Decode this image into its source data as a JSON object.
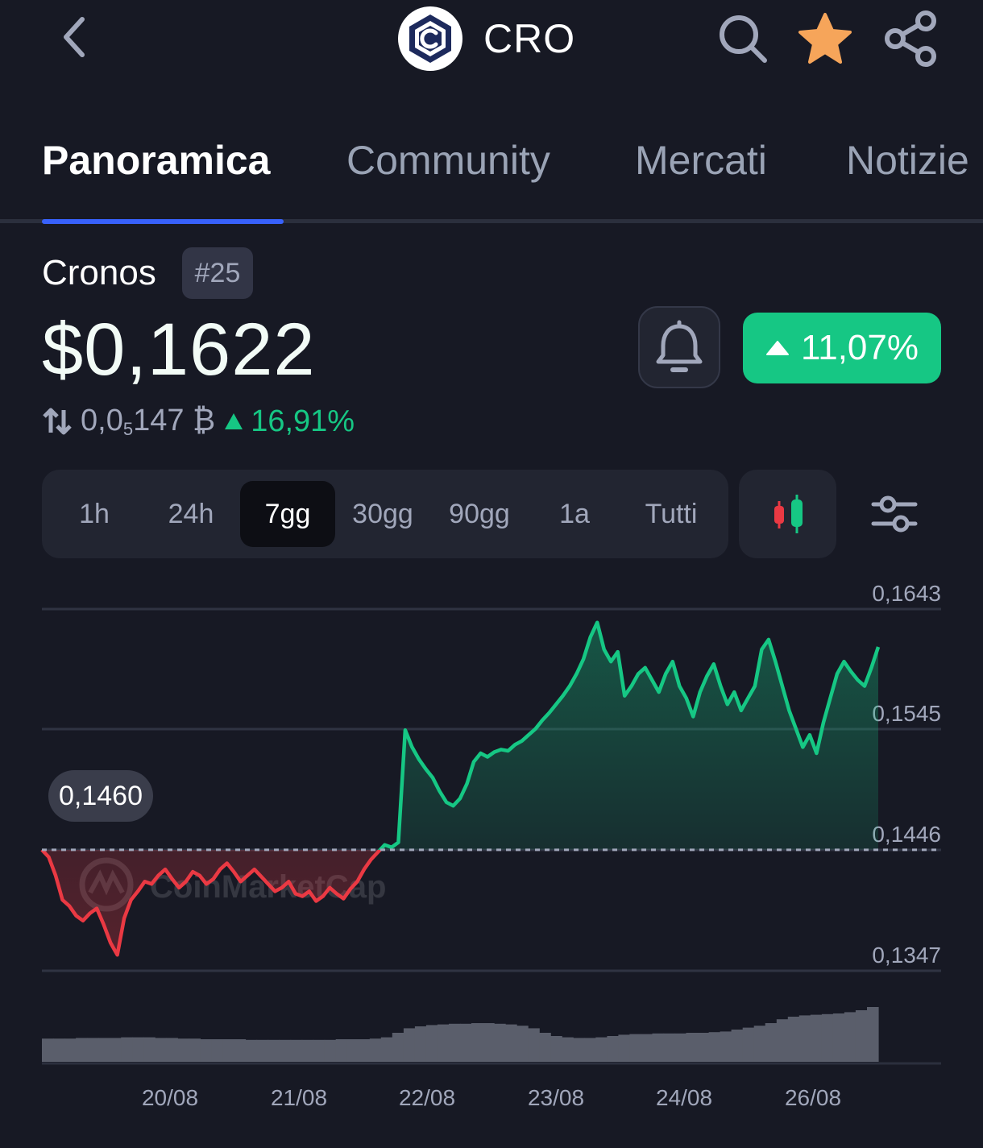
{
  "header": {
    "symbol": "CRO",
    "back_icon": "chevron-left-icon",
    "search_icon": "search-icon",
    "star_icon": "star-icon",
    "share_icon": "share-icon",
    "star_color": "#f6a55a"
  },
  "tabs": [
    {
      "label": "Panoramica",
      "active": true
    },
    {
      "label": "Community",
      "active": false
    },
    {
      "label": "Mercati",
      "active": false
    },
    {
      "label": "Notizie",
      "active": false
    }
  ],
  "coin": {
    "name": "Cronos",
    "rank": "#25",
    "price": "$0,1622",
    "change_24h": "11,07%",
    "btc_price_prefix": "0,0",
    "btc_price_sub": "5",
    "btc_price_suffix": "147",
    "btc_symbol": "₿",
    "btc_change": "16,91%"
  },
  "range": {
    "options": [
      "1h",
      "24h",
      "7gg",
      "30gg",
      "90gg",
      "1a",
      "Tutti"
    ],
    "selected": "7gg"
  },
  "chart_data": {
    "type": "line",
    "title": "",
    "y_ticks": [
      "0,1643",
      "0,1545",
      "0,1446",
      "0,1347"
    ],
    "x_ticks": [
      "20/08",
      "21/08",
      "22/08",
      "23/08",
      "24/08",
      "26/08"
    ],
    "ylim": [
      0.1347,
      0.1643
    ],
    "open_price": 0.1446,
    "open_label": "0,1460",
    "watermark": "CoinMarketCap",
    "colors": {
      "up": "#16c784",
      "down": "#ea3943"
    },
    "series": [
      {
        "values": [
          0.1446,
          0.144,
          0.1425,
          0.1405,
          0.14,
          0.1392,
          0.1388,
          0.1394,
          0.1398,
          0.1385,
          0.137,
          0.136,
          0.139,
          0.1405,
          0.1412,
          0.142,
          0.1418,
          0.1425,
          0.143,
          0.1422,
          0.1415,
          0.142,
          0.1428,
          0.1425,
          0.1418,
          0.1422,
          0.143,
          0.1435,
          0.1428,
          0.142,
          0.1425,
          0.143,
          0.1424,
          0.1418,
          0.1412,
          0.1415,
          0.142,
          0.141,
          0.1408,
          0.1412,
          0.1404,
          0.1408,
          0.1415,
          0.141,
          0.1406,
          0.1414,
          0.142,
          0.143,
          0.1438,
          0.1444,
          0.145,
          0.1448,
          0.1452,
          0.1544,
          0.153,
          0.152,
          0.1512,
          0.1505,
          0.1494,
          0.1485,
          0.1482,
          0.1488,
          0.15,
          0.1518,
          0.1525,
          0.1522,
          0.1526,
          0.1528,
          0.1527,
          0.1532,
          0.1535,
          0.154,
          0.1545,
          0.1552,
          0.1558,
          0.1565,
          0.1572,
          0.158,
          0.159,
          0.1602,
          0.162,
          0.1632,
          0.161,
          0.16,
          0.1608,
          0.1572,
          0.158,
          0.159,
          0.1595,
          0.1585,
          0.1575,
          0.159,
          0.16,
          0.158,
          0.157,
          0.1555,
          0.1575,
          0.1588,
          0.1598,
          0.158,
          0.1565,
          0.1575,
          0.156,
          0.157,
          0.158,
          0.161,
          0.1618,
          0.16,
          0.158,
          0.156,
          0.1545,
          0.153,
          0.154,
          0.1525,
          0.155,
          0.157,
          0.159,
          0.16,
          0.1592,
          0.1585,
          0.158,
          0.1595,
          0.1612
        ]
      }
    ],
    "volume": [
      0.36,
      0.36,
      0.36,
      0.37,
      0.37,
      0.37,
      0.37,
      0.38,
      0.38,
      0.38,
      0.37,
      0.37,
      0.36,
      0.36,
      0.35,
      0.35,
      0.35,
      0.35,
      0.34,
      0.34,
      0.34,
      0.34,
      0.34,
      0.34,
      0.34,
      0.34,
      0.35,
      0.35,
      0.35,
      0.36,
      0.38,
      0.45,
      0.52,
      0.55,
      0.57,
      0.58,
      0.59,
      0.59,
      0.6,
      0.6,
      0.59,
      0.58,
      0.56,
      0.52,
      0.45,
      0.4,
      0.38,
      0.37,
      0.37,
      0.38,
      0.4,
      0.42,
      0.43,
      0.43,
      0.44,
      0.44,
      0.44,
      0.45,
      0.45,
      0.46,
      0.47,
      0.5,
      0.53,
      0.56,
      0.6,
      0.66,
      0.7,
      0.72,
      0.73,
      0.74,
      0.75,
      0.77,
      0.8,
      0.85
    ]
  }
}
